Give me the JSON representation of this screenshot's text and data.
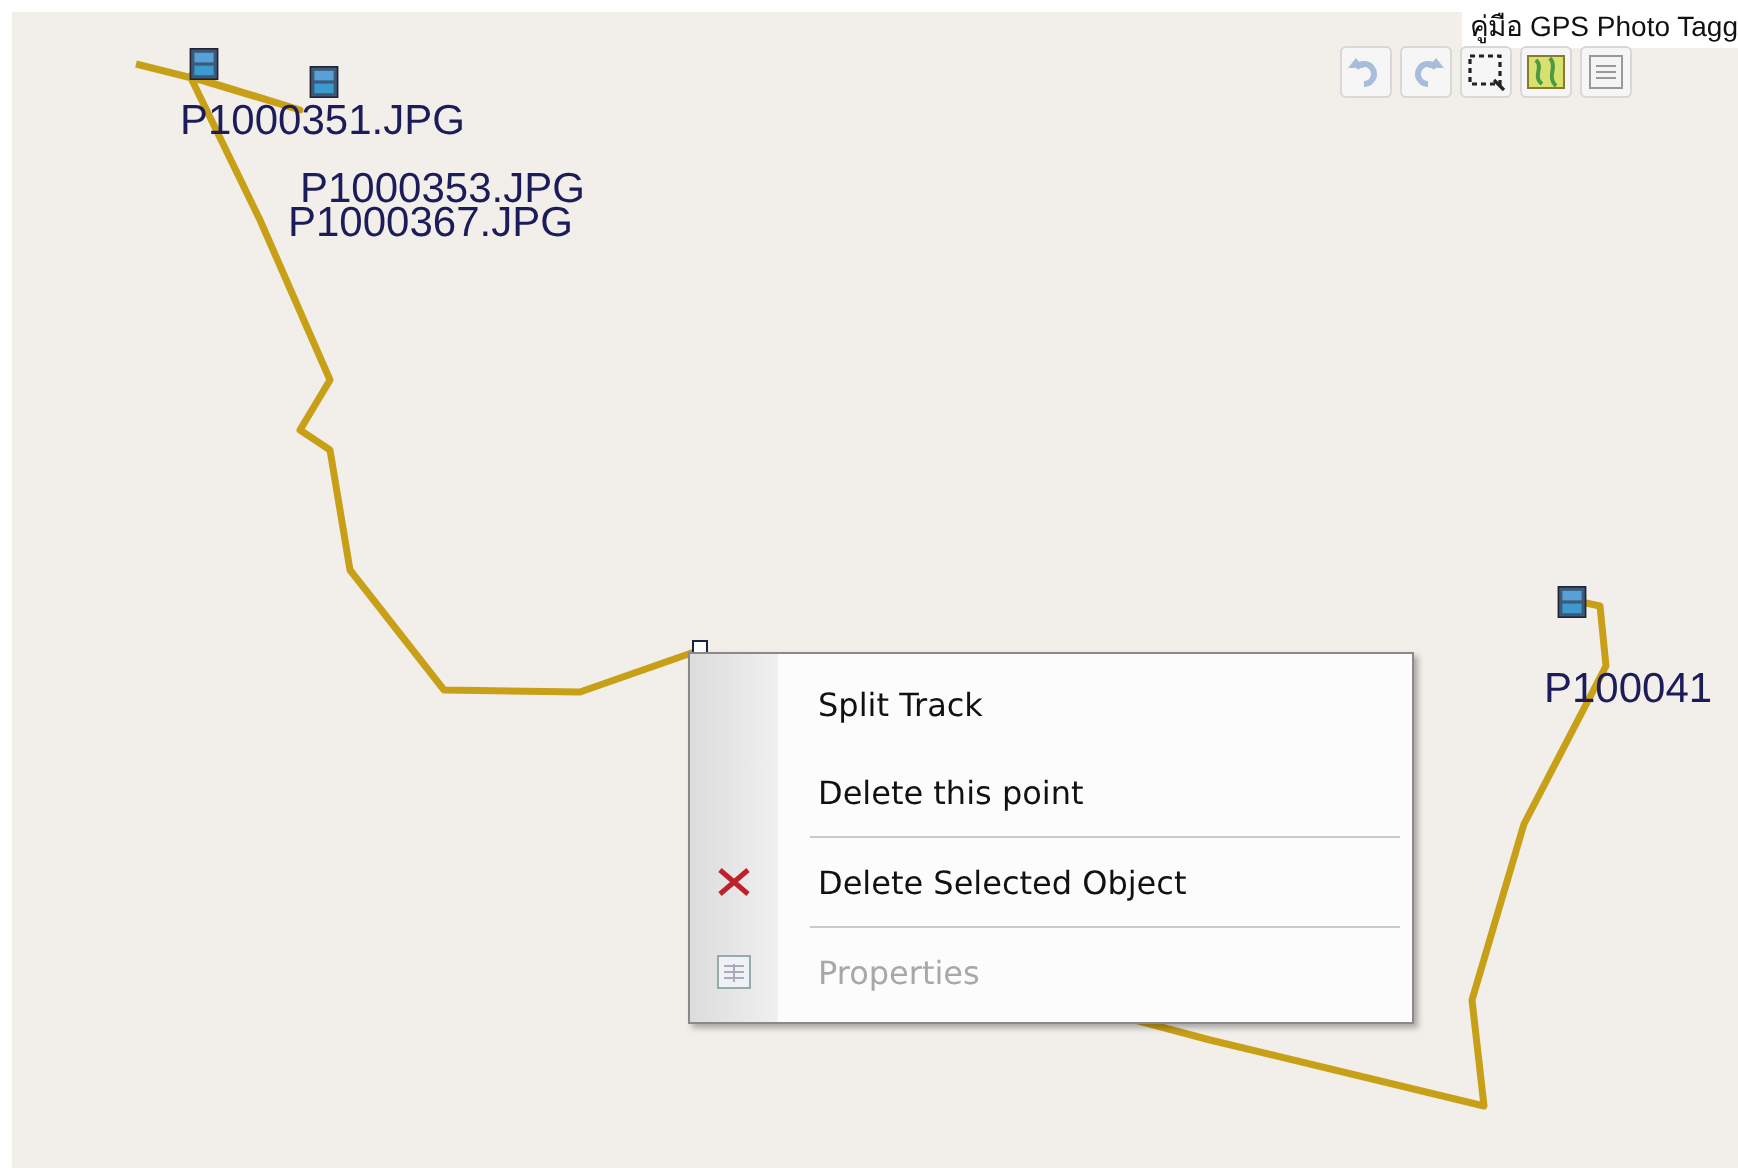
{
  "window": {
    "title": "คู่มือ GPS Photo Tagg"
  },
  "toolbar": [
    {
      "kind": "undo",
      "disabled": true
    },
    {
      "kind": "redo",
      "disabled": true
    },
    {
      "kind": "select",
      "disabled": false
    },
    {
      "kind": "map",
      "disabled": false
    },
    {
      "kind": "list",
      "disabled": false
    }
  ],
  "photos": [
    {
      "label": "P1000351.JPG"
    },
    {
      "label": "P1000353.JPG"
    },
    {
      "label": "P1000367.JPG"
    },
    {
      "label": "P100041"
    }
  ],
  "context_menu": [
    {
      "kind": "item",
      "label": "Split Track",
      "disabled": false
    },
    {
      "kind": "item",
      "label": "Delete this point",
      "disabled": false
    },
    {
      "kind": "separator"
    },
    {
      "kind": "delete",
      "label": "Delete Selected Object",
      "disabled": false
    },
    {
      "kind": "separator"
    },
    {
      "kind": "properties",
      "label": "Properties",
      "disabled": true
    }
  ]
}
